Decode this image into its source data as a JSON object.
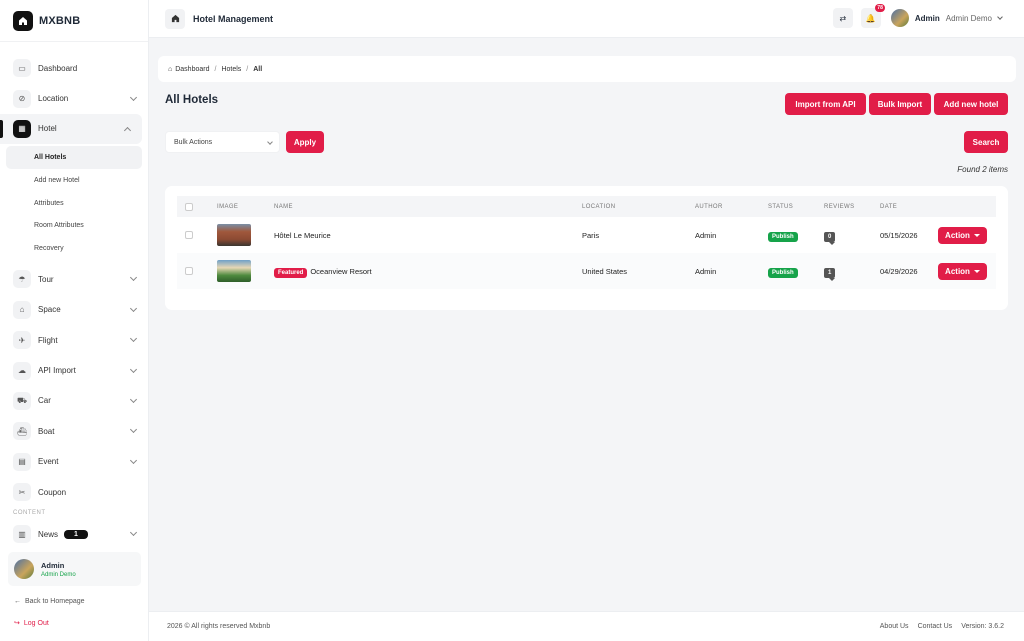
{
  "brand": {
    "name": "MXBNB"
  },
  "sidebar": {
    "items": [
      {
        "label": "Dashboard",
        "icon": "monitor-icon",
        "glyph": "▭"
      },
      {
        "label": "Location",
        "icon": "compass-icon",
        "glyph": "⊘"
      },
      {
        "label": "Hotel",
        "icon": "building-icon",
        "glyph": "▦"
      },
      {
        "label": "Tour",
        "icon": "umbrella-icon",
        "glyph": "☂"
      },
      {
        "label": "Space",
        "icon": "home-icon",
        "glyph": "⌂"
      },
      {
        "label": "Flight",
        "icon": "plane-icon",
        "glyph": "✈"
      },
      {
        "label": "API Import",
        "icon": "cloud-download-icon",
        "glyph": "☁"
      },
      {
        "label": "Car",
        "icon": "car-icon",
        "glyph": "⛟"
      },
      {
        "label": "Boat",
        "icon": "ship-icon",
        "glyph": "⛴"
      },
      {
        "label": "Event",
        "icon": "calendar-icon",
        "glyph": "▤"
      },
      {
        "label": "Coupon",
        "icon": "ticket-icon",
        "glyph": "✂"
      }
    ],
    "hotel_sub": [
      "All Hotels",
      "Add new Hotel",
      "Attributes",
      "Room Attributes",
      "Recovery"
    ],
    "section_content": "CONTENT",
    "news_label": "News",
    "news_count": "1",
    "user_name": "Admin",
    "user_role": "Admin Demo",
    "back_home": "Back to Homepage",
    "logout": "Log Out"
  },
  "topbar": {
    "title": "Hotel Management",
    "notif_count": "78",
    "user": "Admin",
    "user_display": "Admin Demo"
  },
  "breadcrumb": {
    "dashboard": "Dashboard",
    "hotels": "Hotels",
    "current": "All"
  },
  "main": {
    "title": "All Hotels",
    "import_api": "Import from API",
    "bulk_import": "Bulk Import",
    "add_new": "Add new hotel",
    "bulk_actions": "Bulk Actions",
    "apply": "Apply",
    "search": "Search",
    "found": "Found 2 items"
  },
  "table": {
    "headers": [
      "IMAGE",
      "NAME",
      "LOCATION",
      "AUTHOR",
      "STATUS",
      "REVIEWS",
      "DATE"
    ],
    "rows": [
      {
        "name": "Hôtel Le Meurice",
        "featured": "",
        "location": "Paris",
        "author": "Admin",
        "status": "Publish",
        "reviews": "0",
        "date": "05/15/2026",
        "action": "Action"
      },
      {
        "name": "Oceanview Resort",
        "featured": "Featured",
        "location": "United States",
        "author": "Admin",
        "status": "Publish",
        "reviews": "1",
        "date": "04/29/2026",
        "action": "Action"
      }
    ]
  },
  "footer": {
    "copyright": "2026 © All rights reserved Mxbnb",
    "about": "About Us",
    "contact": "Contact Us",
    "version": "Version: 3.6.2"
  },
  "colors": {
    "accent": "#e11d48",
    "publish": "#16a34a",
    "dark": "#111111"
  }
}
